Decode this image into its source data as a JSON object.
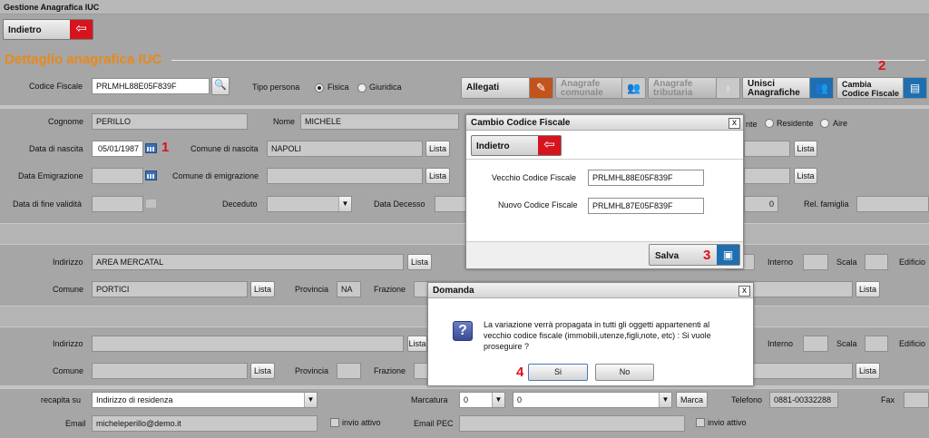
{
  "window": {
    "title": "Gestione Anagrafica IUC"
  },
  "nav": {
    "back_label": "Indietro"
  },
  "section": {
    "title": "Dettaglio anagrafica IUC"
  },
  "top": {
    "cf_label": "Codice Fiscale",
    "cf_value": "PRLMHL88E05F839F",
    "tipo_label": "Tipo persona",
    "fisica": "Fisica",
    "giuridica": "Giuridica"
  },
  "toolbar": {
    "allegati": "Allegati",
    "anag_com_1": "Anagrafe",
    "anag_com_2": "comunale",
    "anag_trib_1": "Anagrafe",
    "anag_trib_2": "tributaria",
    "unisci_1": "Unisci",
    "unisci_2": "Anagrafiche",
    "cambia_1": "Cambia",
    "cambia_2": "Codice Fiscale"
  },
  "form": {
    "cognome_label": "Cognome",
    "cognome": "PERILLO",
    "nome_label": "Nome",
    "nome": "MICHELE",
    "nascita_label": "Data di nascita",
    "nascita": "05/01/1987",
    "comune_nascita_label": "Comune di nascita",
    "comune_nascita": "NAPOLI",
    "emig_label": "Data Emigrazione",
    "comune_emig_label": "Comune di emigrazione",
    "fine_label": "Data di fine validità",
    "deceduto_label": "Deceduto",
    "decesso_label": "Data Decesso",
    "residente_partial": "nte",
    "residente": "Residente",
    "aire": "Aire",
    "rel_value": "0",
    "rel_label": "Rel. famiglia",
    "indirizzo_label": "Indirizzo",
    "indirizzo": "AREA MERCATAL",
    "comune_label": "Comune",
    "comune": "PORTICI",
    "provincia_label": "Provincia",
    "provincia": "NA",
    "frazione_label": "Frazione",
    "interno_label": "Interno",
    "scala_label": "Scala",
    "edificio_label": "Edificio",
    "recapita_label": "recapita su",
    "recapita": "Indirizzo di residenza",
    "marcatura_label": "Marcatura",
    "marcatura_1": "0",
    "marcatura_2": "0",
    "marca": "Marca",
    "telefono_label": "Telefono",
    "telefono": "0881-00332288",
    "fax_label": "Fax",
    "email_label": "Email",
    "email": "micheleperillo@demo.it",
    "invio": "invio attivo",
    "pec_label": "Email PEC",
    "lista": "Lista"
  },
  "dialog_cf": {
    "title": "Cambio Codice Fiscale",
    "back": "Indietro",
    "old_label": "Vecchio Codice Fiscale",
    "old_value": "PRLMHL88E05F839F",
    "new_label": "Nuovo Codice Fiscale",
    "new_value": "PRLMHL87E05F839F",
    "save": "Salva",
    "close": "x"
  },
  "dialog_q": {
    "title": "Domanda",
    "message": "La variazione verrà propagata in tutti gli oggetti appartenenti al vecchio codice fiscale (immobili,utenze,figli,note, etc) : Si vuole proseguire ?",
    "yes": "Si",
    "no": "No",
    "close": "x"
  },
  "markers": {
    "m1": "1",
    "m2": "2",
    "m3": "3",
    "m4": "4"
  },
  "colors": {
    "accent": "#e8891a",
    "red": "#d6141e",
    "blue": "#1f6fb0",
    "bg": "#a6a6a6"
  }
}
